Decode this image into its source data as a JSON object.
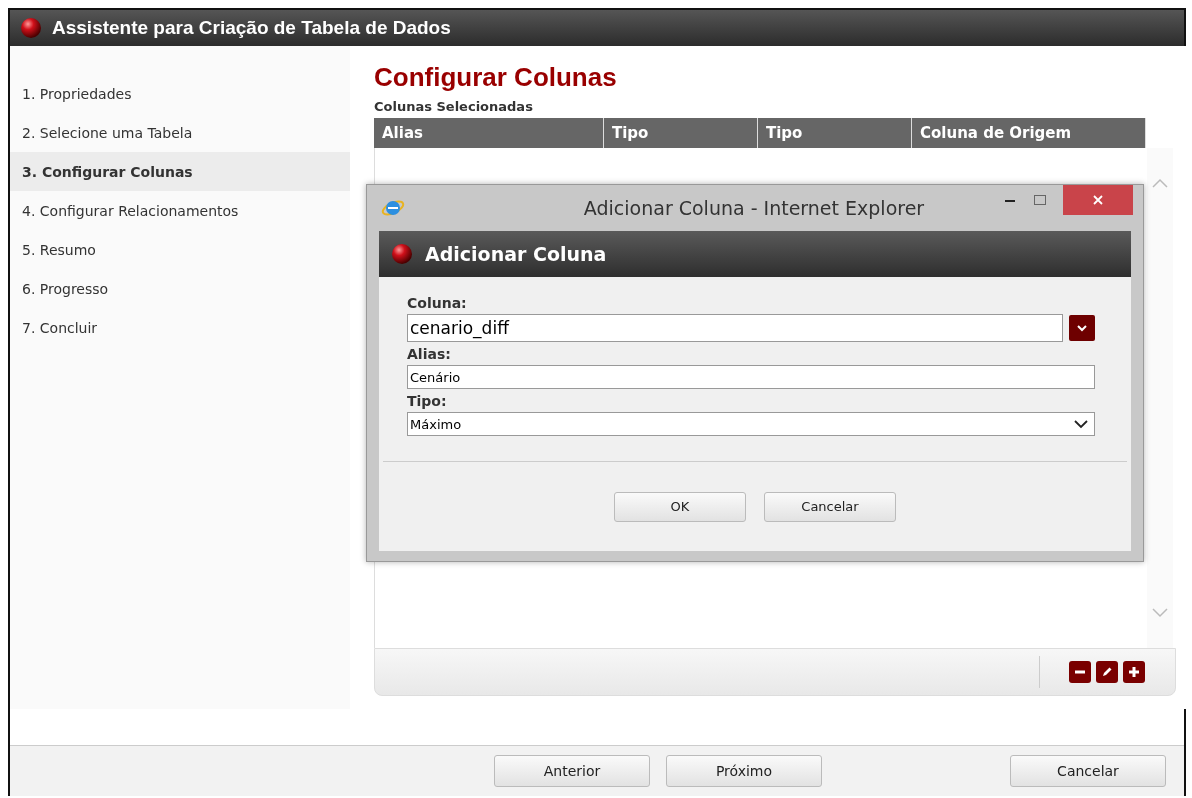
{
  "window": {
    "title": "Assistente para Criação de Tabela de Dados"
  },
  "steps": [
    {
      "label": "1. Propriedades",
      "selected": false
    },
    {
      "label": "2. Selecione uma Tabela",
      "selected": false
    },
    {
      "label": "3. Configurar Colunas",
      "selected": true
    },
    {
      "label": "4. Configurar Relacionamentos",
      "selected": false
    },
    {
      "label": "5. Resumo",
      "selected": false
    },
    {
      "label": "6. Progresso",
      "selected": false
    },
    {
      "label": "7. Concluir",
      "selected": false
    }
  ],
  "page_title": "Configurar Colunas",
  "table": {
    "caption": "Colunas Selecionadas",
    "columns": [
      "Alias",
      "Tipo",
      "Tipo",
      "Coluna de Origem"
    ]
  },
  "navigation": [
    "Anterior",
    "Próximo"
  ],
  "cancel": "Cancelar",
  "dialog": {
    "window_title": "Adicionar Coluna - Internet Explorer",
    "title": "Adicionar Coluna",
    "fields": [
      {
        "label": "Coluna:",
        "value": "cenario_diff",
        "kind": "combo"
      },
      {
        "label": "Alias:",
        "value": "Cenário",
        "kind": "text"
      },
      {
        "label": "Tipo:",
        "value": "Máximo",
        "kind": "select"
      }
    ],
    "buttons": [
      "OK",
      "Cancelar"
    ]
  }
}
